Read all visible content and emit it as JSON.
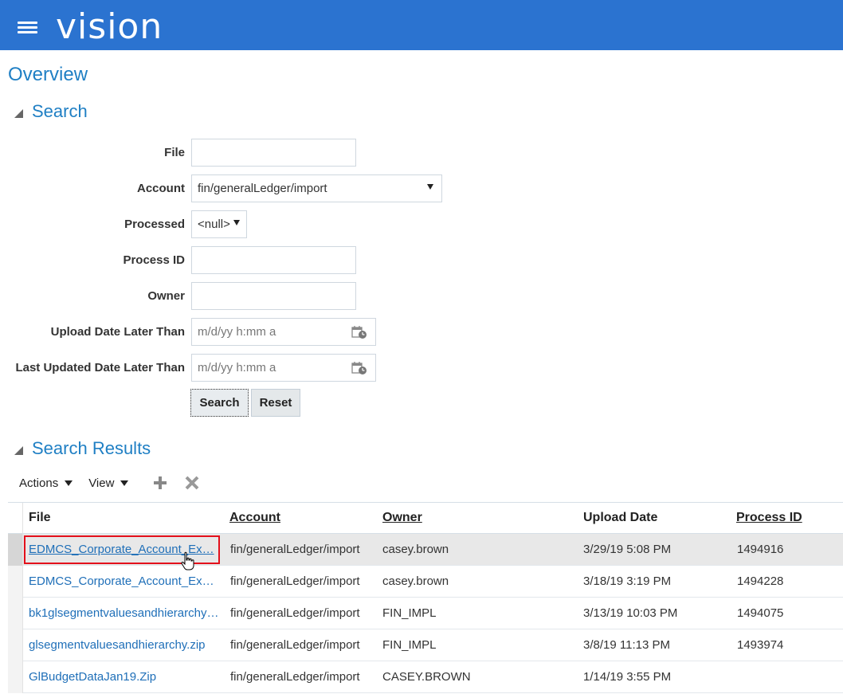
{
  "header": {
    "brand": "vision"
  },
  "page": {
    "title": "Overview"
  },
  "search": {
    "section_title": "Search",
    "fields": {
      "file": {
        "label": "File",
        "value": ""
      },
      "account": {
        "label": "Account",
        "value": "fin/generalLedger/import"
      },
      "processed": {
        "label": "Processed",
        "value": "<null>"
      },
      "process_id": {
        "label": "Process ID",
        "value": ""
      },
      "owner": {
        "label": "Owner",
        "value": ""
      },
      "upload_date": {
        "label": "Upload Date Later Than",
        "placeholder": "m/d/yy h:mm a"
      },
      "last_updated": {
        "label": "Last Updated Date Later Than",
        "placeholder": "m/d/yy h:mm a"
      }
    },
    "search_label": "Search",
    "reset_label": "Reset"
  },
  "results": {
    "section_title": "Search Results",
    "toolbar": {
      "actions": "Actions",
      "view": "View"
    },
    "columns": {
      "file": "File",
      "account": "Account",
      "owner": "Owner",
      "upload_date": "Upload Date",
      "process_id": "Process ID"
    },
    "rows": [
      {
        "file": "EDMCS_Corporate_Account_Ex…",
        "account": "fin/generalLedger/import",
        "owner": "casey.brown",
        "upload_date": "3/29/19 5:08 PM",
        "process_id": "1494916",
        "selected": true
      },
      {
        "file": "EDMCS_Corporate_Account_Ex…",
        "account": "fin/generalLedger/import",
        "owner": "casey.brown",
        "upload_date": "3/18/19 3:19 PM",
        "process_id": "1494228"
      },
      {
        "file": "bk1glsegmentvaluesandhierarchy…",
        "account": "fin/generalLedger/import",
        "owner": "FIN_IMPL",
        "upload_date": "3/13/19 10:03 PM",
        "process_id": "1494075"
      },
      {
        "file": "glsegmentvaluesandhierarchy.zip",
        "account": "fin/generalLedger/import",
        "owner": "FIN_IMPL",
        "upload_date": "3/8/19 11:13 PM",
        "process_id": "1493974"
      },
      {
        "file": "GlBudgetDataJan19.Zip",
        "account": "fin/generalLedger/import",
        "owner": "CASEY.BROWN",
        "upload_date": "1/14/19 3:55 PM",
        "process_id": ""
      }
    ]
  },
  "colors": {
    "header": "#2b73d0",
    "title": "#1f7fc4",
    "link": "#1f6fb8",
    "highlight": "#e3101b"
  }
}
